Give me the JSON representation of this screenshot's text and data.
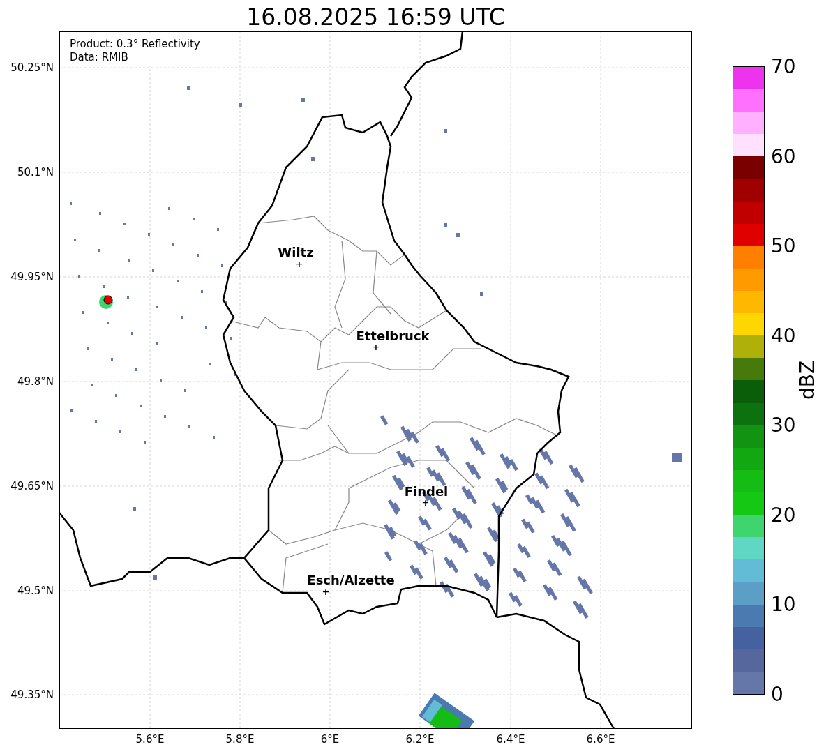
{
  "title": "16.08.2025 16:59 UTC",
  "info_box": [
    "Product: 0.3° Reflectivity",
    "Data: RMIB"
  ],
  "cities": [
    {
      "name": "Wiltz",
      "marker": "+"
    },
    {
      "name": "Ettelbruck",
      "marker": "+"
    },
    {
      "name": "Findel",
      "marker": "+"
    },
    {
      "name": "Esch/Alzette",
      "marker": "+"
    }
  ],
  "x_ticks": [
    "5.6°E",
    "5.8°E",
    "6°E",
    "6.2°E",
    "6.4°E",
    "6.6°E"
  ],
  "y_ticks": [
    "50.25°N",
    "50.1°N",
    "49.95°N",
    "49.8°N",
    "49.65°N",
    "49.5°N",
    "49.35°N"
  ],
  "colorbar": {
    "label": "dBZ",
    "ticks": [
      "70",
      "60",
      "50",
      "40",
      "30",
      "20",
      "10",
      "0"
    ],
    "bins": [
      {
        "color": "#6577a8"
      },
      {
        "color": "#56679e"
      },
      {
        "color": "#4661a0"
      },
      {
        "color": "#4a7ab0"
      },
      {
        "color": "#5b9ec6"
      },
      {
        "color": "#63bcd6"
      },
      {
        "color": "#60d6c4"
      },
      {
        "color": "#3ed46e"
      },
      {
        "color": "#14c814"
      },
      {
        "color": "#14bc14"
      },
      {
        "color": "#12a812"
      },
      {
        "color": "#129412"
      },
      {
        "color": "#0c7210"
      },
      {
        "color": "#0a5e0a"
      },
      {
        "color": "#467a0a"
      },
      {
        "color": "#b0b00a"
      },
      {
        "color": "#ffd700"
      },
      {
        "color": "#ffb700"
      },
      {
        "color": "#ff9a00"
      },
      {
        "color": "#ff7f00"
      },
      {
        "color": "#e00000"
      },
      {
        "color": "#c00000"
      },
      {
        "color": "#a00000"
      },
      {
        "color": "#7a0000"
      },
      {
        "color": "#ffe0ff"
      },
      {
        "color": "#ffb0ff"
      },
      {
        "color": "#ff70ff"
      },
      {
        "color": "#ee33ee"
      }
    ]
  }
}
